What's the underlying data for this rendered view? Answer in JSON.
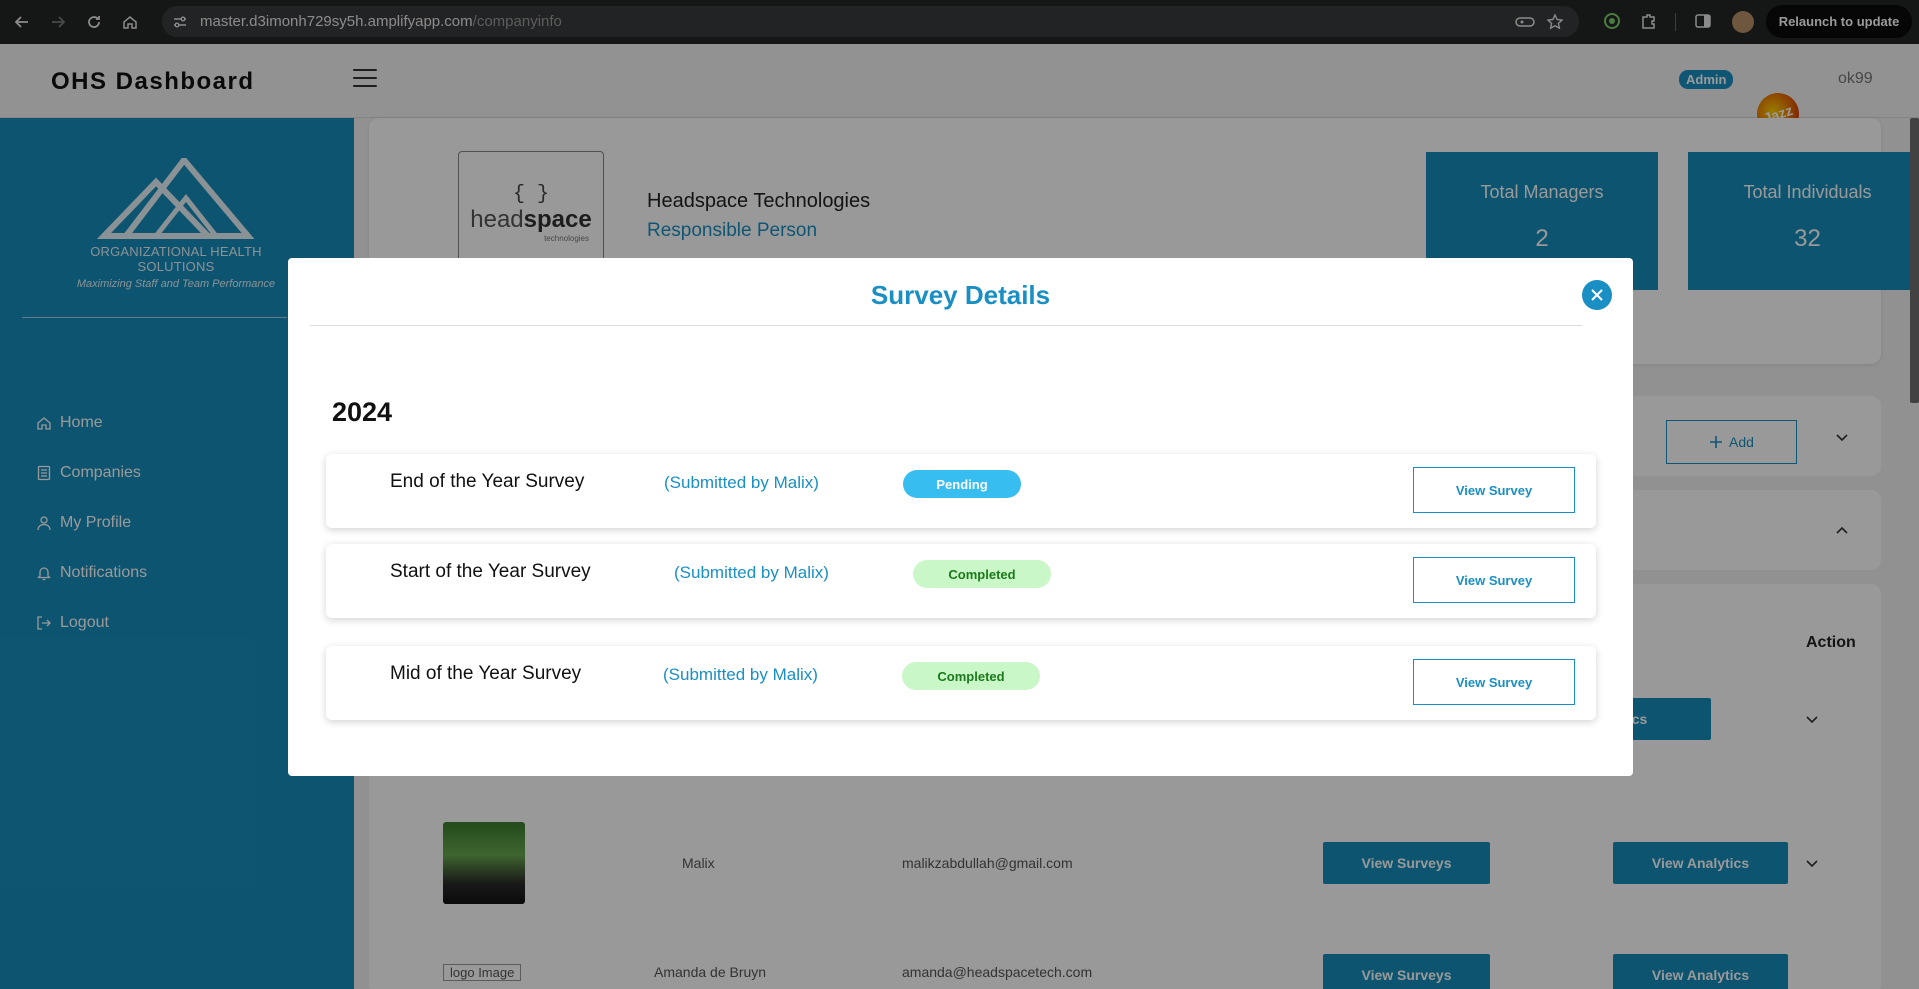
{
  "browser": {
    "url_host": "master.d3imonh729sy5h.amplifyapp.com",
    "url_path": "/companyinfo",
    "relaunch_label": "Relaunch to update"
  },
  "header": {
    "title": "OHS Dashboard",
    "role_badge": "Admin",
    "avatar_text": "Jazz",
    "username": "ok99"
  },
  "sidebar": {
    "logo_org": "ORGANIZATIONAL HEALTH SOLUTIONS",
    "logo_tagline": "Maximizing Staff and Team Performance",
    "items": [
      {
        "label": "Home",
        "icon": "home-icon"
      },
      {
        "label": "Companies",
        "icon": "document-icon"
      },
      {
        "label": "My Profile",
        "icon": "user-icon"
      },
      {
        "label": "Notifications",
        "icon": "bell-icon"
      },
      {
        "label": "Logout",
        "icon": "logout-icon"
      }
    ]
  },
  "company": {
    "logo_brace": "{ }",
    "logo_word_light": "head",
    "logo_word_bold": "space",
    "logo_small": "technologies",
    "name": "Headspace Technologies",
    "responsible_link": "Responsible Person",
    "stats": [
      {
        "label": "Total Managers",
        "value": "2"
      },
      {
        "label": "Total Individuals",
        "value": "32"
      }
    ]
  },
  "actions": {
    "add_label": "Add"
  },
  "table": {
    "headers": {
      "analytics_partial": "ics",
      "action": "Action"
    },
    "rows": [
      {
        "analytics_partial": "cs"
      },
      {
        "name": "Malix",
        "email": "malikzabdullah@gmail.com",
        "surveys_btn": "View Surveys",
        "analytics_btn": "View Analytics"
      },
      {
        "image_alt": "logo Image",
        "name": "Amanda de Bruyn",
        "email": "amanda@headspacetech.com",
        "surveys_btn": "View Surveys",
        "analytics_btn": "View Analytics"
      }
    ]
  },
  "modal": {
    "title": "Survey Details",
    "year": "2024",
    "surveys": [
      {
        "name": "End of the Year Survey",
        "submitted_by": "(Submitted by Malix)",
        "status": "Pending",
        "button": "View Survey"
      },
      {
        "name": "Start of the Year Survey",
        "submitted_by": "(Submitted by Malix)",
        "status": "Completed",
        "button": "View Survey"
      },
      {
        "name": "Mid of the Year Survey",
        "submitted_by": "(Submitted by Malix)",
        "status": "Completed",
        "button": "View Survey"
      }
    ]
  },
  "colors": {
    "accent": "#168dbb",
    "link": "#1a8fc3",
    "pending": "#37bdf0",
    "completed_bg": "#caf7c7",
    "completed_text": "#1c7a1c"
  }
}
